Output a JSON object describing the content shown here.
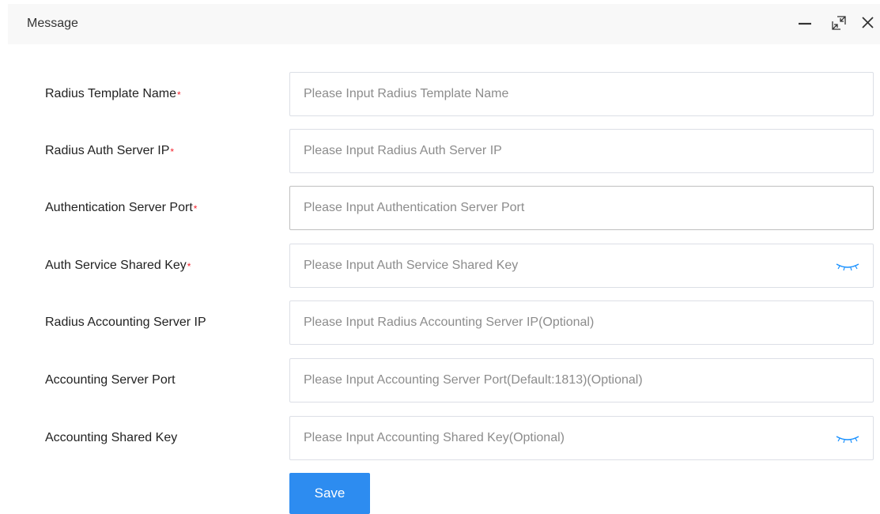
{
  "dialog": {
    "title": "Message",
    "window_controls": [
      {
        "name": "minimize-icon"
      },
      {
        "name": "maximize-icon"
      },
      {
        "name": "close-icon"
      }
    ]
  },
  "form": {
    "required_mark": "*",
    "fields": [
      {
        "label": "Radius Template Name",
        "required": true,
        "placeholder": "Please Input Radius Template Name",
        "value": "",
        "secret": false
      },
      {
        "label": "Radius Auth Server IP",
        "required": true,
        "placeholder": "Please Input Radius Auth Server IP",
        "value": "",
        "secret": false
      },
      {
        "label": "Authentication Server Port",
        "required": true,
        "placeholder": "Please Input Authentication Server Port",
        "value": "",
        "secret": false
      },
      {
        "label": "Auth Service Shared Key",
        "required": true,
        "placeholder": "Please Input Auth Service Shared Key",
        "value": "",
        "secret": true
      },
      {
        "label": "Radius Accounting Server IP",
        "required": false,
        "placeholder": "Please Input Radius Accounting Server IP(Optional)",
        "value": "",
        "secret": false
      },
      {
        "label": "Accounting Server Port",
        "required": false,
        "placeholder": "Please Input Accounting Server Port(Default:1813)(Optional)",
        "value": "",
        "secret": false
      },
      {
        "label": "Accounting Shared Key",
        "required": false,
        "placeholder": "Please Input Accounting Shared Key(Optional)",
        "value": "",
        "secret": true
      }
    ],
    "save_label": "Save"
  },
  "colors": {
    "primary": "#2d8cf0",
    "required": "#f5222d",
    "eye_icon": "#1890ff"
  },
  "icons": {
    "password_toggle": "eye-closed-icon"
  }
}
